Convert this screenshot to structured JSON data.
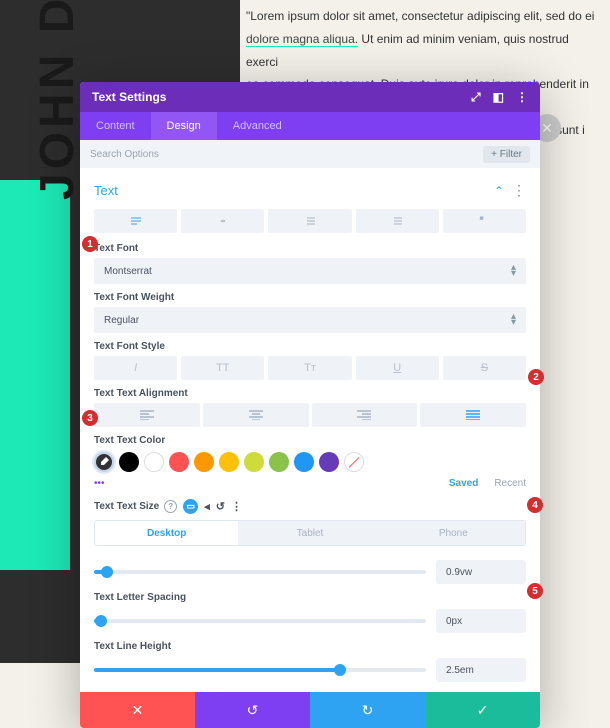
{
  "background": {
    "name": "JOHN DOE",
    "lorem_line1": "\"Lorem ipsum dolor sit amet, consectetur adipiscing elit, sed do ei",
    "lorem_hl": "dolore magna aliqua.",
    "lorem_line2a": " Ut enim ad minim veniam, quis nostrud exerci",
    "lorem_line3": "ea commodo consequat. Duis aute irure dolor in reprehenderit in vol",
    "lorem_line4": "tat non proident, sunt i"
  },
  "modal": {
    "title": "Text Settings",
    "tabs": [
      "Content",
      "Design",
      "Advanced"
    ],
    "active_tab": 1,
    "search_placeholder": "Search Options",
    "filter_label": "Filter",
    "section_title": "Text",
    "fields": {
      "font_label": "Text Font",
      "font_value": "Montserrat",
      "weight_label": "Text Font Weight",
      "weight_value": "Regular",
      "style_label": "Text Font Style",
      "style_buttons": [
        "I",
        "TT",
        "Tт",
        "U",
        "S"
      ],
      "align_label": "Text Text Alignment",
      "color_label": "Text Text Color",
      "color_tabs": {
        "saved": "Saved",
        "recent": "Recent"
      },
      "colors": [
        "#000000",
        "#ffffff",
        "#ff5252",
        "#ff9800",
        "#ffc107",
        "#cddc39",
        "#8bc34a",
        "#2196f3",
        "#673ab7"
      ],
      "size_label": "Text Text Size",
      "device_tabs": [
        "Desktop",
        "Tablet",
        "Phone"
      ],
      "active_device": 0,
      "size_value": "0.9vw",
      "size_percent": 4,
      "spacing_label": "Text Letter Spacing",
      "spacing_value": "0px",
      "spacing_percent": 2,
      "line_height_label": "Text Line Height",
      "line_height_value": "2.5em",
      "line_height_percent": 74
    }
  },
  "markers": [
    "1",
    "2",
    "3",
    "4",
    "5"
  ]
}
